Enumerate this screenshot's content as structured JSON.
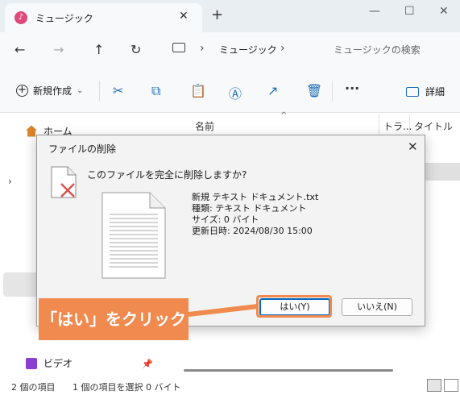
{
  "window": {
    "tab_title": "ミュージック",
    "tab_close": "✕",
    "new_tab": "+",
    "minimize": "—",
    "maximize": "☐",
    "close": "✕"
  },
  "nav": {
    "back": "←",
    "forward": "→",
    "up": "↑",
    "refresh": "↻",
    "separator": "›",
    "crumb": "ミュージック",
    "search_placeholder": "ミュージックの検索"
  },
  "command_bar": {
    "new_label": "新規作成",
    "new_caret": "⌄",
    "more": "···",
    "details_label": "詳細"
  },
  "sidebar": {
    "items": [
      {
        "label": "ホーム",
        "icon": "home-icon"
      },
      {
        "label": "ビデオ",
        "icon": "video-icon"
      }
    ],
    "expander": "›",
    "pin": "📌"
  },
  "file_list": {
    "columns": [
      "名前",
      "トラ...",
      "タイトル"
    ],
    "sort_caret": "^"
  },
  "status": {
    "item_count": "2 個の項目",
    "selection": "1 個の項目を選択  0 バイト"
  },
  "dialog": {
    "title": "ファイルの削除",
    "close": "✕",
    "question": "このファイルを完全に削除しますか?",
    "file_name": "新規 テキスト ドキュメント.txt",
    "type_line": "種類: テキスト ドキュメント",
    "size_line": "サイズ: 0 バイト",
    "date_line": "更新日時: 2024/08/30 15:00",
    "yes_button": "はい(Y)",
    "no_button": "いいえ(N)"
  },
  "annotation": {
    "callout_text": "「はい」をクリック",
    "color": "#f08a4f"
  },
  "colors": {
    "accent": "#1f6fb8",
    "music_icon": "#e0487a",
    "delete_x": "#d9534f"
  }
}
